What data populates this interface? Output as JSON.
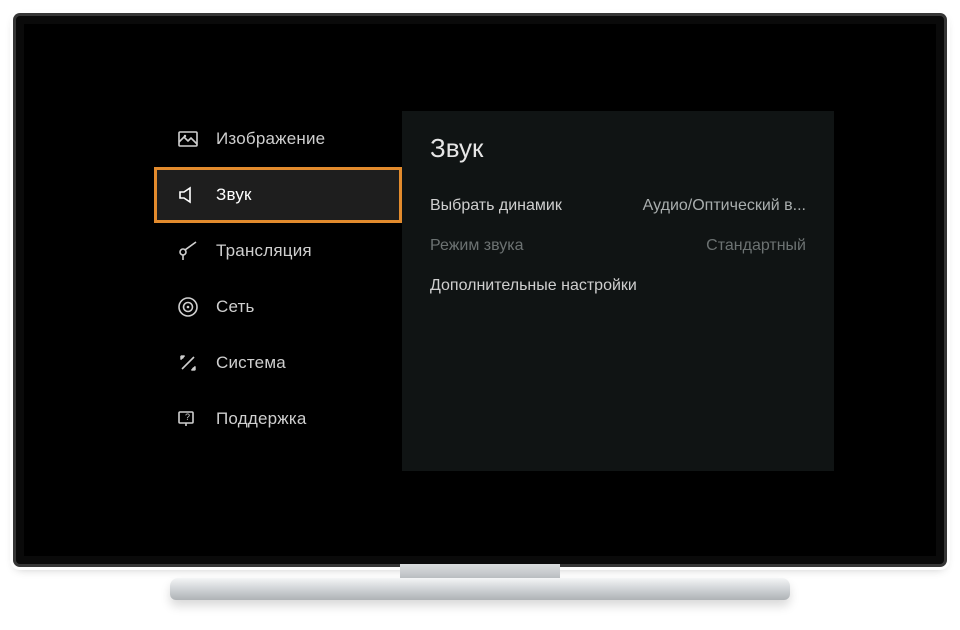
{
  "sidebar": {
    "items": [
      {
        "icon": "picture-icon",
        "label": "Изображение",
        "selected": false
      },
      {
        "icon": "speaker-icon",
        "label": "Звук",
        "selected": true
      },
      {
        "icon": "broadcast-icon",
        "label": "Трансляция",
        "selected": false
      },
      {
        "icon": "network-icon",
        "label": "Сеть",
        "selected": false
      },
      {
        "icon": "system-icon",
        "label": "Система",
        "selected": false
      },
      {
        "icon": "support-icon",
        "label": "Поддержка",
        "selected": false
      }
    ]
  },
  "content": {
    "title": "Звук",
    "options": [
      {
        "label": "Выбрать динамик",
        "value": "Аудио/Оптический в...",
        "disabled": false
      },
      {
        "label": "Режим звука",
        "value": "Стандартный",
        "disabled": true
      },
      {
        "label": "Дополнительные настройки",
        "value": "",
        "disabled": false
      }
    ]
  },
  "highlight_color": "#e38b2d"
}
